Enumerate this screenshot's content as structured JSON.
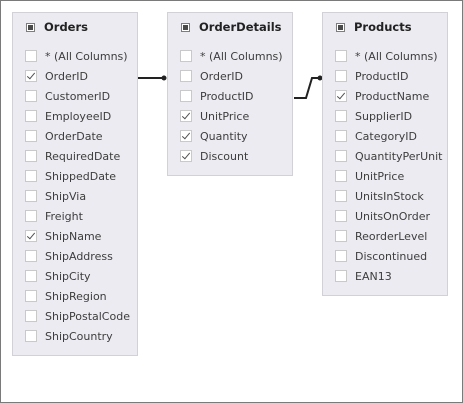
{
  "tables": [
    {
      "id": "orders",
      "title": "Orders",
      "fields": [
        {
          "label": "* (All Columns)",
          "checked": false
        },
        {
          "label": "OrderID",
          "checked": true
        },
        {
          "label": "CustomerID",
          "checked": false
        },
        {
          "label": "EmployeeID",
          "checked": false
        },
        {
          "label": "OrderDate",
          "checked": false
        },
        {
          "label": "RequiredDate",
          "checked": false
        },
        {
          "label": "ShippedDate",
          "checked": false
        },
        {
          "label": "ShipVia",
          "checked": false
        },
        {
          "label": "Freight",
          "checked": false
        },
        {
          "label": "ShipName",
          "checked": true
        },
        {
          "label": "ShipAddress",
          "checked": false
        },
        {
          "label": "ShipCity",
          "checked": false
        },
        {
          "label": "ShipRegion",
          "checked": false
        },
        {
          "label": "ShipPostalCode",
          "checked": false
        },
        {
          "label": "ShipCountry",
          "checked": false
        }
      ]
    },
    {
      "id": "orderdetails",
      "title": "OrderDetails",
      "fields": [
        {
          "label": "* (All Columns)",
          "checked": false
        },
        {
          "label": "OrderID",
          "checked": false
        },
        {
          "label": "ProductID",
          "checked": false
        },
        {
          "label": "UnitPrice",
          "checked": true
        },
        {
          "label": "Quantity",
          "checked": true
        },
        {
          "label": "Discount",
          "checked": true
        }
      ]
    },
    {
      "id": "products",
      "title": "Products",
      "fields": [
        {
          "label": "* (All Columns)",
          "checked": false
        },
        {
          "label": "ProductID",
          "checked": false
        },
        {
          "label": "ProductName",
          "checked": true
        },
        {
          "label": "SupplierID",
          "checked": false
        },
        {
          "label": "CategoryID",
          "checked": false
        },
        {
          "label": "QuantityPerUnit",
          "checked": false
        },
        {
          "label": "UnitPrice",
          "checked": false
        },
        {
          "label": "UnitsInStock",
          "checked": false
        },
        {
          "label": "UnitsOnOrder",
          "checked": false
        },
        {
          "label": "ReorderLevel",
          "checked": false
        },
        {
          "label": "Discontinued",
          "checked": false
        },
        {
          "label": "EAN13",
          "checked": false
        }
      ]
    }
  ],
  "relations": [
    {
      "from_table": "Orders",
      "from_field": "OrderID",
      "to_table": "OrderDetails",
      "to_field": "OrderID"
    },
    {
      "from_table": "OrderDetails",
      "from_field": "ProductID",
      "to_table": "Products",
      "to_field": "ProductID"
    }
  ],
  "colors": {
    "panel_background": "#ecebf1",
    "panel_border": "#d2d1d8",
    "connector": "#222222",
    "frame_border": "#7a7a7a"
  }
}
